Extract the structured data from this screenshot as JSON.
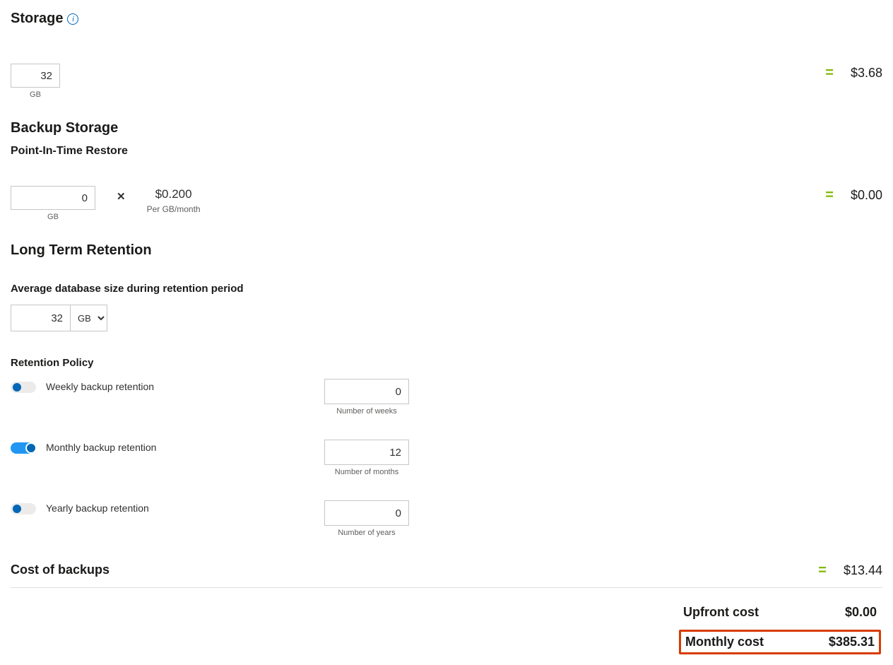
{
  "storage": {
    "heading": "Storage",
    "value": "32",
    "unit": "GB",
    "result": "$3.68"
  },
  "backup": {
    "heading": "Backup Storage",
    "subheading": "Point-In-Time Restore",
    "value": "0",
    "unit": "GB",
    "mult": "✕",
    "rate": "$0.200",
    "rate_unit": "Per GB/month",
    "result": "$0.00"
  },
  "ltr": {
    "heading": "Long Term Retention",
    "avg_label": "Average database size during retention period",
    "avg_value": "32",
    "avg_unit": "GB",
    "policy_label": "Retention Policy",
    "weekly": {
      "label": "Weekly backup retention",
      "value": "0",
      "caption": "Number of weeks",
      "on": false
    },
    "monthly": {
      "label": "Monthly backup retention",
      "value": "12",
      "caption": "Number of months",
      "on": true
    },
    "yearly": {
      "label": "Yearly backup retention",
      "value": "0",
      "caption": "Number of years",
      "on": false
    }
  },
  "backups_cost": {
    "label": "Cost of backups",
    "result": "$13.44"
  },
  "equals": "=",
  "totals": {
    "upfront_label": "Upfront cost",
    "upfront_value": "$0.00",
    "monthly_label": "Monthly cost",
    "monthly_value": "$385.31"
  }
}
